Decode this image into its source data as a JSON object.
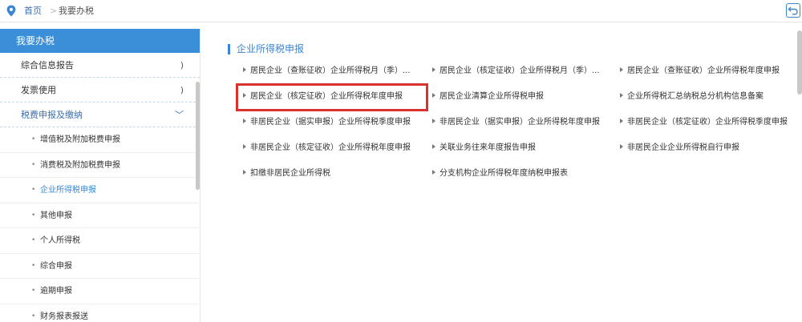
{
  "breadcrumb": {
    "home": "首页",
    "separator": ">",
    "current": "我要办税"
  },
  "icons": {
    "location": "map-pin-icon",
    "back": "return-icon"
  },
  "colors": {
    "accent": "#3b8fd8",
    "link": "#3a86d1",
    "highlight": "#d6322e"
  },
  "sidebar": {
    "title": "我要办税",
    "items": [
      {
        "label": "综合信息报告",
        "arrow": ")"
      },
      {
        "label": "发票使用",
        "arrow": ")"
      },
      {
        "label": "税费申报及缴纳",
        "arrow": "﹀"
      }
    ],
    "subitems": [
      {
        "label": "增值税及附加税费申报"
      },
      {
        "label": "消费税及附加税费申报"
      },
      {
        "label": "企业所得税申报"
      },
      {
        "label": "其他申报"
      },
      {
        "label": "个人所得税"
      },
      {
        "label": "综合申报"
      },
      {
        "label": "逾期申报"
      },
      {
        "label": "财务报表报送"
      }
    ]
  },
  "main": {
    "section_title": "企业所得税申报",
    "links": [
      "居民企业（查账征收）企业所得税月（季）...",
      "居民企业（核定征收）企业所得税月（季）...",
      "居民企业（查账征收）企业所得税年度申报",
      "居民企业（核定征收）企业所得税年度申报",
      "居民企业清算企业所得税申报",
      "企业所得税汇总纳税总分机构信息备案",
      "非居民企业（据实申报）企业所得税季度申报",
      "非居民企业（据实申报）企业所得税年度申报",
      "非居民企业（核定征收）企业所得税季度申报",
      "非居民企业（核定征收）企业所得税年度申报",
      "关联业务往来年度报告申报",
      "非居民企业企业所得税自行申报",
      "扣缴非居民企业所得税",
      "分支机构企业所得税年度纳税申报表"
    ]
  }
}
